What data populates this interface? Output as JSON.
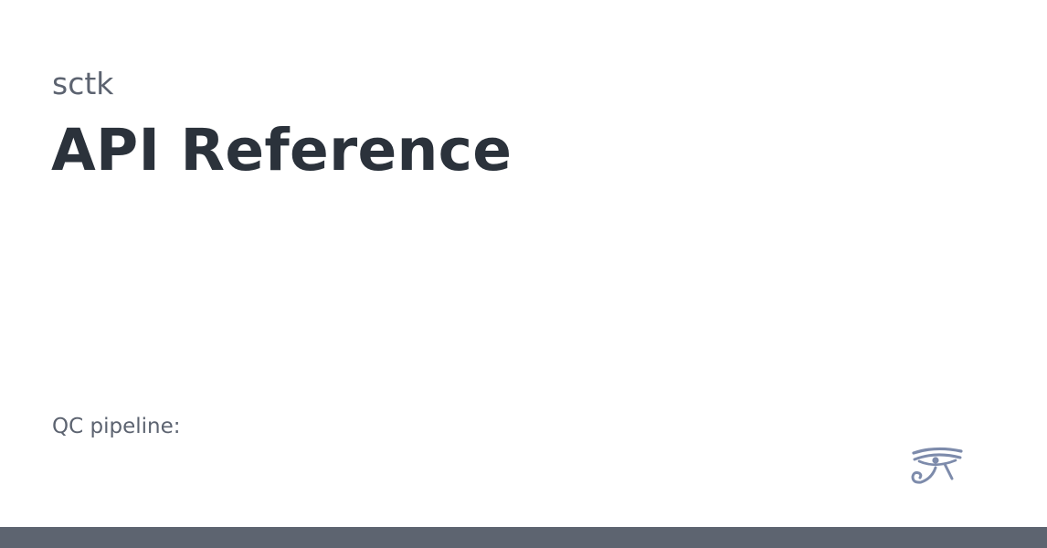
{
  "card": {
    "project_name": "sctk",
    "title": "API Reference",
    "description": "QC pipeline:",
    "logo_icon": "eye-of-horus-icon"
  },
  "colors": {
    "title": "#2b323b",
    "muted_text": "#5c6370",
    "logo": "#7d8bab",
    "footer_bar": "#5d6470",
    "background": "#ffffff"
  }
}
